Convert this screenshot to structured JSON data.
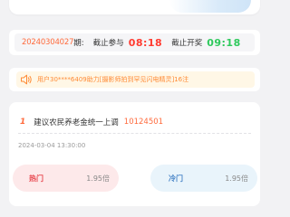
{
  "period": {
    "number": "20240304027",
    "suffix": "期:",
    "close_bet_label": "截止参与",
    "close_bet_time": "08:18",
    "close_open_label": "截止开奖",
    "close_open_time": "09:18"
  },
  "notice": {
    "text": "用户30****6409助力[摄影师拍到罕见闪电精灵]16注"
  },
  "topic": {
    "index": "1",
    "title": "建议农民养老金统一上调",
    "id": "10124501",
    "time": "2024-03-04 13:30:00",
    "options": [
      {
        "name": "热门",
        "odds": "1.95倍",
        "color": "#e8474f"
      },
      {
        "name": "冷门",
        "odds": "1.95倍",
        "color": "#4a86c8"
      }
    ]
  },
  "colors": {
    "accent_orange": "#ff6b3d",
    "deadline_red": "#ff3b30",
    "open_green": "#2ec95c",
    "notice_bg": "#fff7e6"
  }
}
